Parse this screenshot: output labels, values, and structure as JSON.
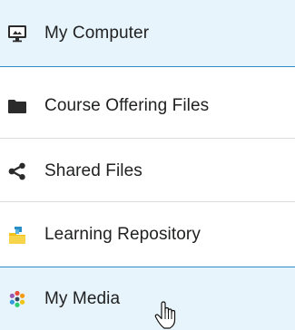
{
  "menu": {
    "items": [
      {
        "label": "My Computer",
        "icon": "monitor-icon",
        "selected": true
      },
      {
        "label": "Course Offering Files",
        "icon": "folder-icon",
        "selected": false
      },
      {
        "label": "Shared Files",
        "icon": "share-icon",
        "selected": false
      },
      {
        "label": "Learning Repository",
        "icon": "repository-icon",
        "selected": false
      },
      {
        "label": "My Media",
        "icon": "media-icon",
        "selected": true
      }
    ]
  },
  "colors": {
    "selected_bg": "#e8f4fb",
    "accent_line": "#2a8ec6",
    "divider": "#d9dcde",
    "text": "#202122",
    "icon": "#2b2b2b"
  }
}
